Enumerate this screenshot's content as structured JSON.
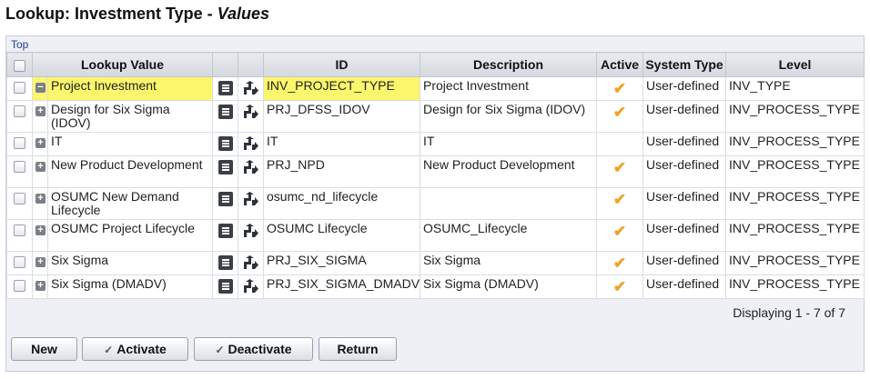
{
  "title": {
    "prefix": "Lookup: Investment Type - ",
    "suffix": "Values"
  },
  "top_link": "Top",
  "columns": [
    "Lookup Value",
    "ID",
    "Description",
    "Active",
    "System Type",
    "Level"
  ],
  "rows": [
    {
      "lookup_value": "Project Investment",
      "id": "INV_PROJECT_TYPE",
      "description": "Project Investment",
      "active": true,
      "system_type": "User-defined",
      "level": "INV_TYPE",
      "expander": "−"
    },
    {
      "lookup_value": "Design for Six Sigma (IDOV)",
      "id": "PRJ_DFSS_IDOV",
      "description": "Design for Six Sigma (IDOV)",
      "active": true,
      "system_type": "User-defined",
      "level": "INV_PROCESS_TYPE",
      "expander": "+"
    },
    {
      "lookup_value": "IT",
      "id": "IT",
      "description": "IT",
      "active": false,
      "system_type": "User-defined",
      "level": "INV_PROCESS_TYPE",
      "expander": "+"
    },
    {
      "lookup_value": "New Product Development",
      "id": "PRJ_NPD",
      "description": "New Product Development",
      "active": true,
      "system_type": "User-defined",
      "level": "INV_PROCESS_TYPE",
      "expander": "+"
    },
    {
      "lookup_value": "OSUMC New Demand Lifecycle",
      "id": "osumc_nd_lifecycle",
      "description": "",
      "active": true,
      "system_type": "User-defined",
      "level": "INV_PROCESS_TYPE",
      "expander": "+"
    },
    {
      "lookup_value": "OSUMC Project Lifecycle",
      "id": "OSUMC Lifecycle",
      "description": "OSUMC_Lifecycle",
      "active": true,
      "system_type": "User-defined",
      "level": "INV_PROCESS_TYPE",
      "expander": "+"
    },
    {
      "lookup_value": "Six Sigma",
      "id": "PRJ_SIX_SIGMA",
      "description": "Six Sigma",
      "active": true,
      "system_type": "User-defined",
      "level": "INV_PROCESS_TYPE",
      "expander": "+"
    },
    {
      "lookup_value": "Six Sigma (DMADV)",
      "id": "PRJ_SIX_SIGMA_DMADV",
      "description": "Six Sigma (DMADV)",
      "active": true,
      "system_type": "User-defined",
      "level": "INV_PROCESS_TYPE",
      "expander": "+"
    }
  ],
  "status": "Displaying 1 - 7 of 7",
  "buttons": {
    "new": "New",
    "activate": "Activate",
    "deactivate": "Deactivate",
    "return": "Return"
  },
  "icons": {
    "checkbox": "checkbox-icon",
    "list": "list-icon",
    "move": "move-icon",
    "check": "checkmark-icon"
  },
  "colors": {
    "highlight": "#fbf66b",
    "check": "#f2a12b",
    "link": "#1f3f8f",
    "panel": "#eef0f6"
  }
}
